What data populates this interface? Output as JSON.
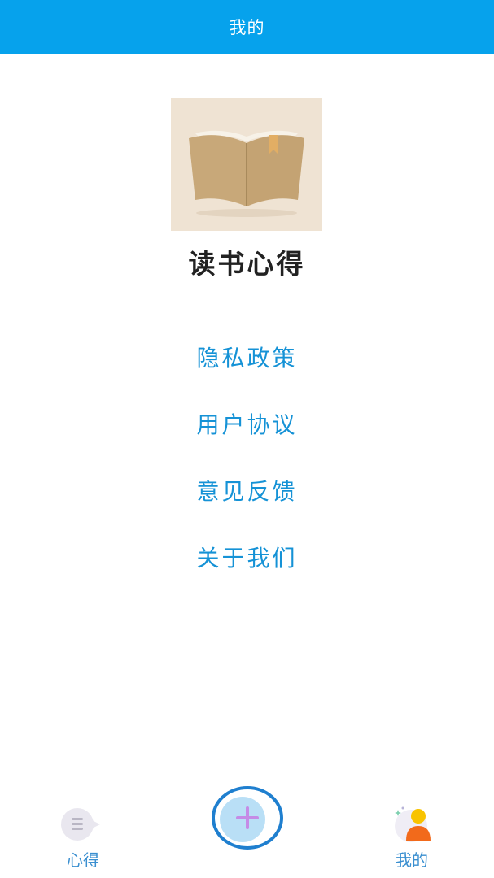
{
  "header": {
    "title": "我的"
  },
  "app": {
    "name": "读书心得"
  },
  "menu": [
    {
      "label": "隐私政策"
    },
    {
      "label": "用户协议"
    },
    {
      "label": "意见反馈"
    },
    {
      "label": "关于我们"
    }
  ],
  "tabbar": {
    "notes_label": "心得",
    "add_icon": "plus-icon",
    "mine_label": "我的"
  },
  "colors": {
    "header_bg": "#06a2ec",
    "menu_text": "#1592d6",
    "tab_text": "#3a8fd0",
    "add_ring": "#1f7fcf",
    "add_plus": "#c58be6"
  }
}
